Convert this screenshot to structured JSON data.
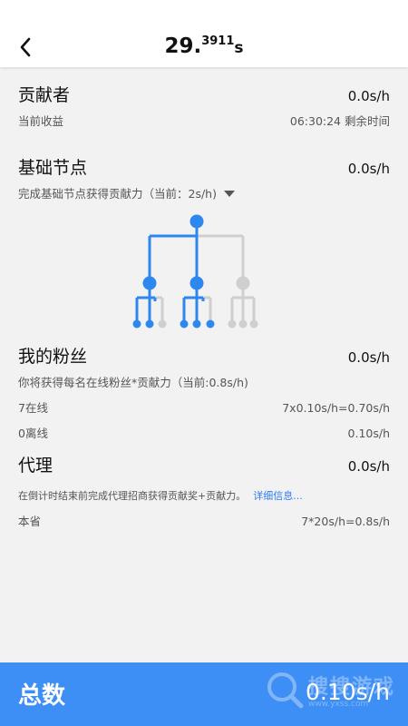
{
  "header": {
    "title_main": "29.",
    "title_small": "3911",
    "title_unit": "s"
  },
  "contributor": {
    "title": "贡献者",
    "rate": "0.0s/h",
    "sub_left": "当前收益",
    "sub_right": "06:30:24 剩余时间"
  },
  "base_node": {
    "title": "基础节点",
    "rate": "0.0s/h",
    "desc": "完成基础节点获得贡献力（当前：2s/h)"
  },
  "tree": {
    "active_color": "#2e86ef",
    "inactive_color": "#cfcfcf"
  },
  "fans": {
    "title": "我的粉丝",
    "rate": "0.0s/h",
    "desc": "你将获得每名在线粉丝*贡献力（当前:0.8s/h)",
    "online_label": "7在线",
    "online_value": "7x0.10s/h=0.70s/h",
    "offline_label": "0离线",
    "offline_value": "0.10s/h"
  },
  "agent": {
    "title": "代理",
    "rate": "0.0s/h",
    "desc": "在倒计时结束前完成代理招商获得贡献奖+贡献力。",
    "link": "详细信息...",
    "province_label": "本省",
    "province_value": "7*20s/h=0.8s/h"
  },
  "footer": {
    "label": "总数",
    "total": "0.10s/h",
    "watermark": "搜搜游戏",
    "watermark_url": "www.yxss.com"
  }
}
